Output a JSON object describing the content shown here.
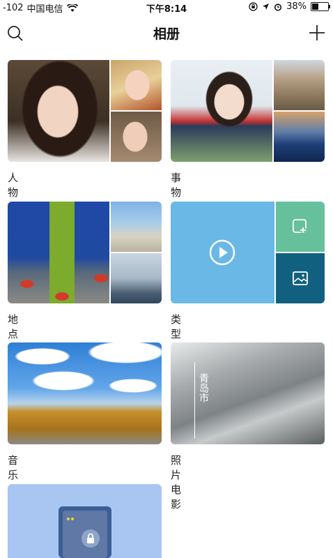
{
  "status": {
    "signal": "-102",
    "carrier": "中国电信",
    "time": "下午8:14",
    "battery": "38%",
    "battery_level": 0.38
  },
  "nav": {
    "title": "相册",
    "search_icon": "search-icon",
    "add_icon": "plus-icon"
  },
  "albums": [
    {
      "label": "人物"
    },
    {
      "label": "事物"
    },
    {
      "label": "地点"
    },
    {
      "label": "类型"
    },
    {
      "label": "音乐相册"
    },
    {
      "label": "照片电影",
      "cover_text": "青岛市"
    },
    {
      "label": ""
    }
  ],
  "colors": {
    "type_main": "#6ab8e6",
    "type_green": "#67c09c",
    "type_dark": "#12607f",
    "locked_bg": "#a9c6f3"
  }
}
